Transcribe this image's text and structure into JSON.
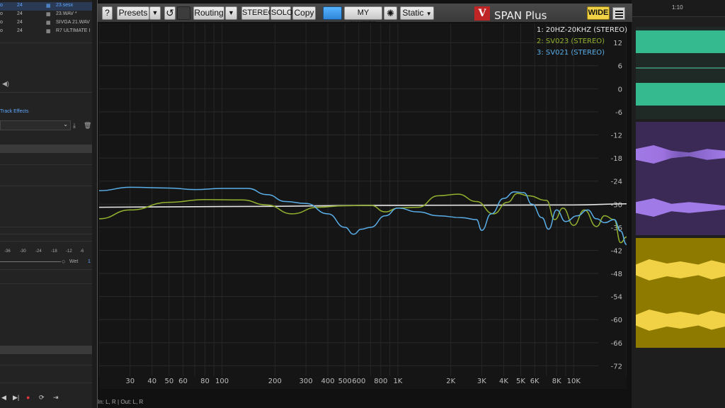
{
  "daw_left": {
    "files": [
      {
        "col1": "o",
        "col2": "24",
        "name": "23.sesx",
        "selected": true
      },
      {
        "col1": "o",
        "col2": "24",
        "name": "23.WAV *",
        "selected": false
      },
      {
        "col1": "o",
        "col2": "24",
        "name": "SIVGA 21.WAV",
        "selected": false
      },
      {
        "col1": "o",
        "col2": "24",
        "name": "R7 ULTIMATE I",
        "selected": false
      }
    ],
    "track_effects_label": "Track Effects",
    "meter_scale": [
      "-36",
      "-30",
      "-24",
      "-18",
      "-12",
      "-6"
    ],
    "wet_label": "Wet",
    "wet_value": "1"
  },
  "toolbar": {
    "help_label": "?",
    "presets_label": "Presets",
    "routing_label": "Routing",
    "stereo_label": "STEREO",
    "solo_label": "SOLO",
    "copy_label": "Copy",
    "sweep_label": "MY SWEEP",
    "static_label": "Static",
    "logo_letter": "V",
    "plugin_name": "SPAN Plus",
    "wide_label": "WIDE",
    "arrow_glyph": "▼",
    "reset_glyph": "↺",
    "gear_glyph": "✺"
  },
  "status_bar": "In: L, R | Out: L, R",
  "colors": {
    "series1": "#e6e6e6",
    "series2": "#92b12f",
    "series3": "#5aaee8",
    "wide_accent": "#f1d247"
  },
  "daw_right": {
    "ruler_label": "1:10"
  },
  "chart_data": {
    "type": "line",
    "x_scale": "log",
    "xlim": [
      20,
      20000
    ],
    "ylim": [
      -78,
      17
    ],
    "x_ticks": [
      {
        "v": 30,
        "label": "30"
      },
      {
        "v": 40,
        "label": "40"
      },
      {
        "v": 50,
        "label": "50"
      },
      {
        "v": 60,
        "label": "60"
      },
      {
        "v": 80,
        "label": "80"
      },
      {
        "v": 100,
        "label": "100"
      },
      {
        "v": 200,
        "label": "200"
      },
      {
        "v": 300,
        "label": "300"
      },
      {
        "v": 400,
        "label": "400"
      },
      {
        "v": 500,
        "label": "500"
      },
      {
        "v": 600,
        "label": "600"
      },
      {
        "v": 800,
        "label": "800"
      },
      {
        "v": 1000,
        "label": "1K"
      },
      {
        "v": 2000,
        "label": "2K"
      },
      {
        "v": 3000,
        "label": "3K"
      },
      {
        "v": 4000,
        "label": "4K"
      },
      {
        "v": 5000,
        "label": "5K"
      },
      {
        "v": 6000,
        "label": "6K"
      },
      {
        "v": 8000,
        "label": "8K"
      },
      {
        "v": 10000,
        "label": "10K"
      }
    ],
    "y_ticks": [
      12,
      6,
      0,
      -6,
      -12,
      -18,
      -24,
      -30,
      -36,
      -42,
      -48,
      -54,
      -60,
      -66,
      -72
    ],
    "legend": [
      "1: 20HZ-20KHZ (STEREO)",
      "2: SV023 (STEREO)",
      "3: SV021 (STEREO)"
    ],
    "series": [
      {
        "name": "1: 20HZ-20KHZ (STEREO)",
        "color": "#e6e6e6",
        "points": [
          [
            20,
            -30.8
          ],
          [
            100,
            -30.6
          ],
          [
            1000,
            -30.3
          ],
          [
            10000,
            -30.2
          ],
          [
            20000,
            -29.9
          ]
        ]
      },
      {
        "name": "2: SV023 (STEREO)",
        "color": "#92b12f",
        "points": [
          [
            20,
            -33.8
          ],
          [
            30,
            -31.5
          ],
          [
            50,
            -29.5
          ],
          [
            80,
            -28.8
          ],
          [
            130,
            -28.9
          ],
          [
            180,
            -30.2
          ],
          [
            250,
            -32.5
          ],
          [
            350,
            -30.8
          ],
          [
            500,
            -30.4
          ],
          [
            700,
            -30.3
          ],
          [
            850,
            -32.0
          ],
          [
            1000,
            -31.0
          ],
          [
            1300,
            -30.8
          ],
          [
            1700,
            -27.8
          ],
          [
            2200,
            -27.4
          ],
          [
            2800,
            -29.3
          ],
          [
            3500,
            -32.5
          ],
          [
            4200,
            -29.5
          ],
          [
            4800,
            -27.2
          ],
          [
            5500,
            -27.8
          ],
          [
            7000,
            -29.0
          ],
          [
            7800,
            -34.0
          ],
          [
            8700,
            -31.0
          ],
          [
            10000,
            -35.5
          ],
          [
            11500,
            -31.5
          ],
          [
            13500,
            -35.8
          ],
          [
            15000,
            -33.0
          ],
          [
            17000,
            -34.0
          ],
          [
            18500,
            -40.0
          ],
          [
            20000,
            -38.5
          ]
        ]
      },
      {
        "name": "3: SV021 (STEREO)",
        "color": "#5aaee8",
        "points": [
          [
            20,
            -26.5
          ],
          [
            30,
            -25.6
          ],
          [
            50,
            -25.8
          ],
          [
            70,
            -26.2
          ],
          [
            100,
            -25.9
          ],
          [
            140,
            -25.9
          ],
          [
            180,
            -27.5
          ],
          [
            230,
            -29.3
          ],
          [
            300,
            -29.8
          ],
          [
            400,
            -32.5
          ],
          [
            500,
            -36.0
          ],
          [
            560,
            -37.8
          ],
          [
            620,
            -36.5
          ],
          [
            700,
            -36.0
          ],
          [
            850,
            -33.0
          ],
          [
            1000,
            -31.0
          ],
          [
            1300,
            -32.0
          ],
          [
            1700,
            -33.0
          ],
          [
            2300,
            -33.5
          ],
          [
            2800,
            -34.0
          ],
          [
            3000,
            -36.8
          ],
          [
            3400,
            -32.5
          ],
          [
            4000,
            -28.5
          ],
          [
            4600,
            -26.8
          ],
          [
            5200,
            -27.0
          ],
          [
            5800,
            -30.0
          ],
          [
            6600,
            -33.5
          ],
          [
            7200,
            -36.5
          ],
          [
            8000,
            -31.5
          ],
          [
            9000,
            -34.5
          ],
          [
            10500,
            -33.0
          ],
          [
            12000,
            -31.5
          ],
          [
            13500,
            -33.8
          ],
          [
            15000,
            -34.8
          ],
          [
            17000,
            -34.0
          ],
          [
            18500,
            -37.0
          ],
          [
            20000,
            -40.5
          ]
        ]
      }
    ]
  }
}
